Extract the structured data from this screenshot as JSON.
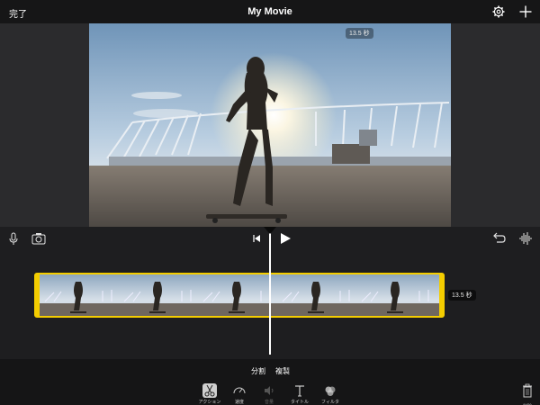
{
  "header": {
    "done_label": "完了",
    "title": "My Movie"
  },
  "viewer": {
    "duration": "13.5 秒"
  },
  "timeline": {
    "clip_duration": "13.5 秒"
  },
  "edit_actions": {
    "split": "分割",
    "duplicate": "複製"
  },
  "tools": [
    {
      "label": "アクション",
      "icon": "scissors-icon",
      "selected": true
    },
    {
      "label": "速度",
      "icon": "speedometer-icon"
    },
    {
      "label": "音量",
      "icon": "speaker-icon",
      "disabled": true
    },
    {
      "label": "タイトル",
      "icon": "title-icon"
    },
    {
      "label": "フィルタ",
      "icon": "filter-icon"
    }
  ],
  "trash": {
    "label": "削除",
    "icon": "trash-icon"
  },
  "colors": {
    "accent": "#f4cd00",
    "chrome": "#161617",
    "panel": "#1e1e20"
  }
}
